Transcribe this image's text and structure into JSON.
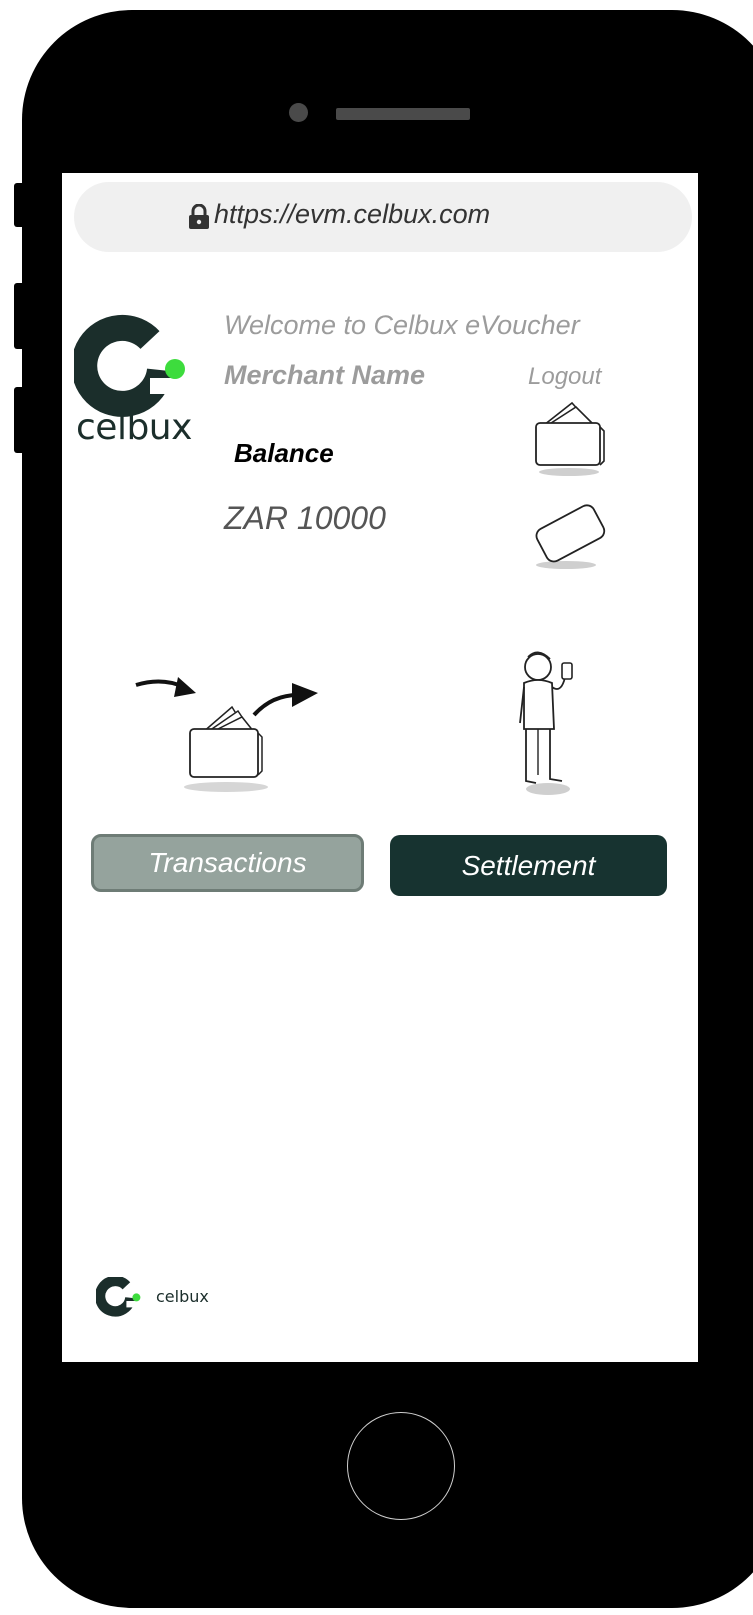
{
  "browser": {
    "url": "https://evm.celbux.com"
  },
  "brand": {
    "logo_text": "celbux",
    "footer_text": "celbux",
    "colors": {
      "primary_dark": "#1b2e2b",
      "accent_green": "#3ddc3d"
    }
  },
  "header": {
    "welcome_text": "Welcome to Celbux eVoucher",
    "merchant_name": "Merchant Name",
    "logout_label": "Logout"
  },
  "balance": {
    "label": "Balance",
    "value": "ZAR 10000"
  },
  "actions": {
    "transactions_label": "Transactions",
    "settlement_label": "Settlement"
  },
  "icons": {
    "lock": "lock-icon",
    "wallet": "wallet-icon",
    "card": "card-icon",
    "transactions": "transactions-illustration",
    "settlement": "person-phone-illustration"
  }
}
